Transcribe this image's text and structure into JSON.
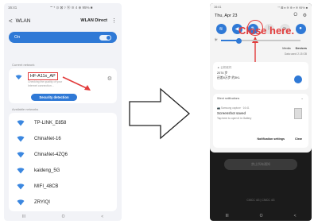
{
  "left": {
    "status": {
      "time": "16:41",
      "icons": "\"\" * ⊙ ⊠ ▿ Ⓝ ≋ 4 ⊕ 95% ■"
    },
    "header": {
      "back": "<",
      "title": "WLAN",
      "direct": "WLAN Direct",
      "kebab": "⋮"
    },
    "toggle_label": "On",
    "current_label": "Current network",
    "current": {
      "name": "HF-A11x_AP",
      "sub": "Checking the quality of your Internet connection..."
    },
    "security_button": "Security detection",
    "available_label": "Available networks",
    "networks": [
      "TP-LINK_E858",
      "ChinaNet-16",
      "ChinaNet-4ZQ6",
      "kaideng_5G",
      "MIFI_48CB",
      "ZRYIQI"
    ],
    "nav": [
      "III",
      "O",
      "<"
    ]
  },
  "right": {
    "status": {
      "time": "16:41",
      "icons": "\"\" ⊠ ♦ ≋ ⊕ ▿ ≋ 95% ■"
    },
    "date": "Thu, Apr 23",
    "top_icons": [
      "O",
      "⚙"
    ],
    "media": {
      "media": "Media",
      "devices": "Devices"
    },
    "media_sub": "Data used: 2.15 GB",
    "notif1": {
      "source": "▲ 云机软件",
      "line1": "2074 步",
      "line2": "还差8万步 约3KL"
    },
    "close_text": "Close here.",
    "notif2": {
      "header": "Silent notifications",
      "chev": "⌄",
      "app": "📷 Samsung capture · 16:41",
      "title": "Screenshot saved",
      "sub": "Tap here to open it in Gallery",
      "settings": "Notification settings",
      "clear": "Clear"
    },
    "dim_button": "禁止所有通知",
    "dim_text": "CMCC 4G | CMCC 4G",
    "nav": [
      "III",
      "O",
      "<"
    ]
  },
  "colors": {
    "accent": "#2f79d6",
    "highlight": "#e23b3b"
  }
}
